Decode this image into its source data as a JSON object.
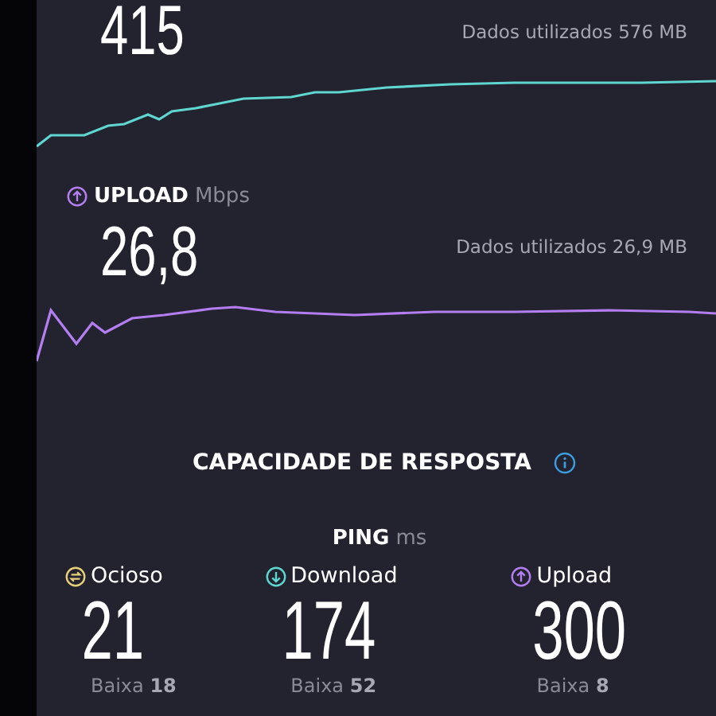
{
  "download": {
    "value": "415",
    "data_used": "Dados utilizados 576 MB"
  },
  "upload": {
    "label": "UPLOAD",
    "unit": "Mbps",
    "value": "26,8",
    "data_used": "Dados utilizados 26,9 MB"
  },
  "responsiveness": {
    "title": "CAPACIDADE DE RESPOSTA",
    "ping": {
      "label": "PING",
      "unit": "ms"
    },
    "items": [
      {
        "kind": "idle",
        "label": "Ocioso",
        "value": "21",
        "low_label": "Baixa",
        "low": "18"
      },
      {
        "kind": "download",
        "label": "Download",
        "value": "174",
        "low_label": "Baixa",
        "low": "52"
      },
      {
        "kind": "upload",
        "label": "Upload",
        "value": "300",
        "low_label": "Baixa",
        "low": "8"
      }
    ]
  }
}
